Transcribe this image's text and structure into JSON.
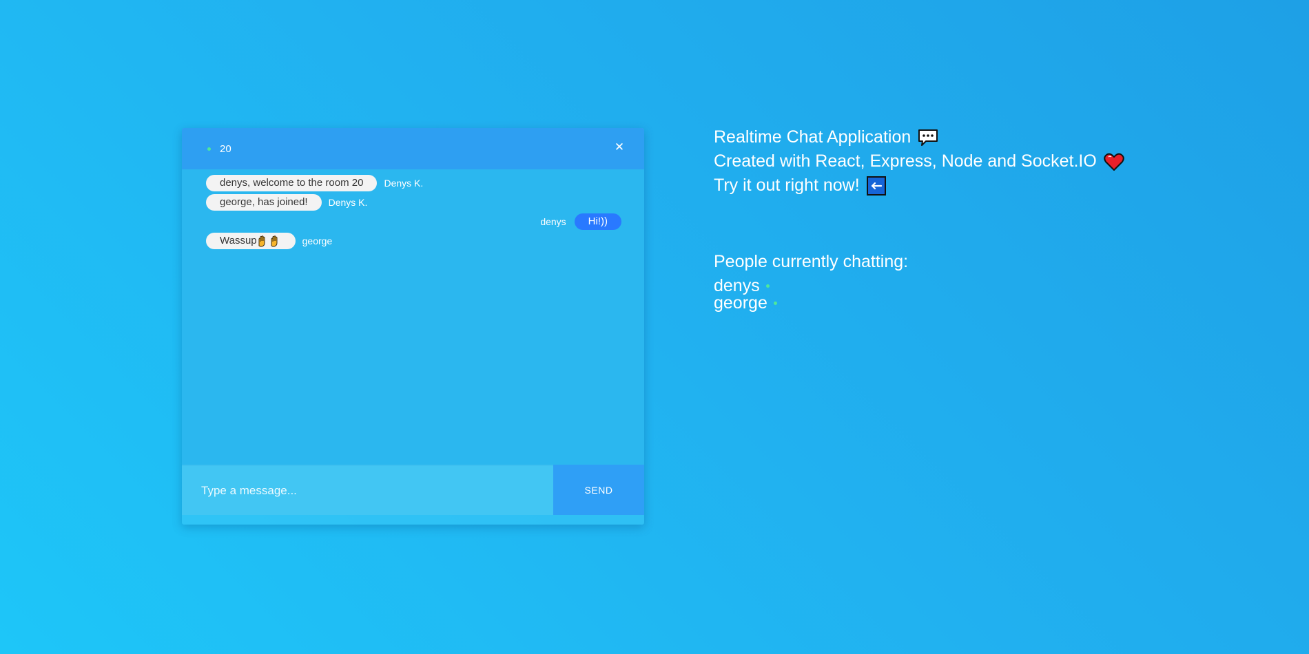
{
  "chat": {
    "room_name": "20",
    "close_symbol": "✕",
    "messages": [
      {
        "text": "denys, welcome to the room 20",
        "sender": "Denys K.",
        "side": "left"
      },
      {
        "text": "george, has joined!",
        "sender": "Denys K.",
        "side": "left"
      },
      {
        "text": "Hi!))",
        "sender": "denys",
        "side": "right"
      },
      {
        "text": "Wassup",
        "sender": "george",
        "side": "left"
      }
    ],
    "input_placeholder": "Type a message...",
    "send_label": "SEND"
  },
  "info": {
    "line1": "Realtime Chat Application",
    "line2": "Created with React, Express, Node and Socket.IO",
    "line3": "Try it out right now!",
    "line1_icon": "speech-bubble-icon",
    "line2_icon": "heart-icon",
    "line3_icon": "left-arrow-icon"
  },
  "people": {
    "title": "People currently chatting:",
    "users": [
      "denys",
      "george"
    ]
  },
  "colors": {
    "accent": "#2979ff",
    "header": "#2e9ff2",
    "online": "#4fe89a",
    "heart": "#e8202a"
  }
}
